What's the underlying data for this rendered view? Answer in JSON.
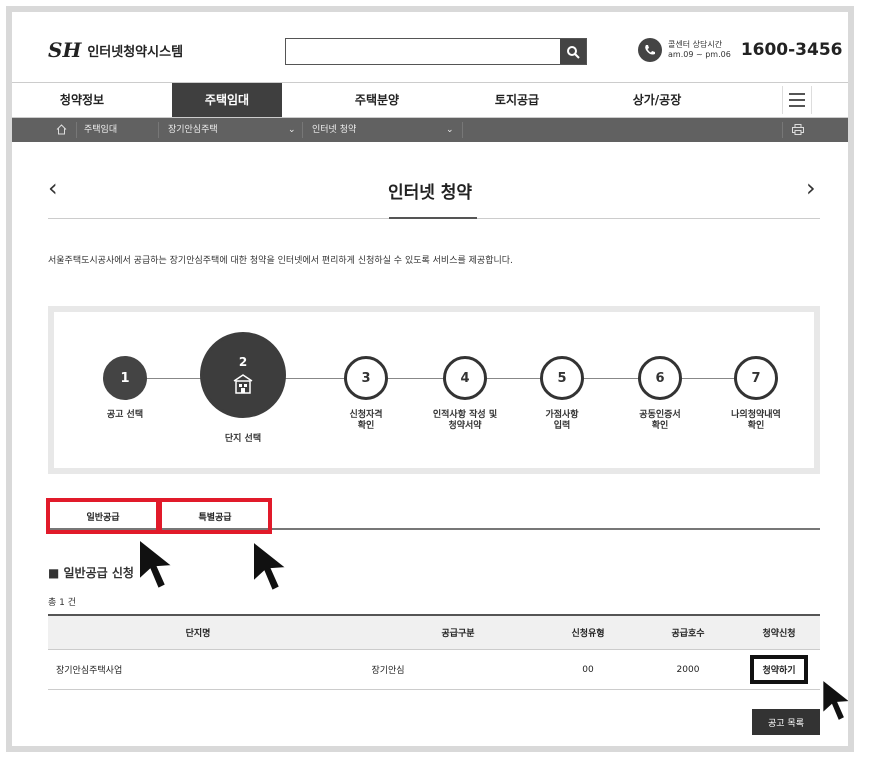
{
  "header": {
    "logo_mark": "SH",
    "logo_text": "인터넷청약시스템",
    "search_placeholder": "",
    "call_label_line1": "콜센터 상담시간",
    "call_label_line2": "am.09 ~ pm.06",
    "call_number": "1600-3456"
  },
  "nav": {
    "items": [
      "청약정보",
      "주택임대",
      "주택분양",
      "토지공급",
      "상가/공장"
    ],
    "active_index": 1
  },
  "breadcrumb": {
    "items": [
      "주택임대",
      "장기안심주택",
      "인터넷 청약"
    ]
  },
  "page": {
    "title": "인터넷 청약",
    "description": "서울주택도시공사에서 공급하는 장기안심주택에 대한 청약을 인터넷에서 편리하게 신청하실 수 있도록 서비스를 제공합니다."
  },
  "steps": [
    {
      "number": "1",
      "label": "공고 선택",
      "state": "done"
    },
    {
      "number": "2",
      "label": "단지 선택",
      "state": "current",
      "icon": "building-icon"
    },
    {
      "number": "3",
      "label": "신청자격\n확인",
      "state": "todo"
    },
    {
      "number": "4",
      "label": "인적사항 작성 및\n청약서약",
      "state": "todo"
    },
    {
      "number": "5",
      "label": "가점사항\n입력",
      "state": "todo"
    },
    {
      "number": "6",
      "label": "공동인증서\n확인",
      "state": "todo"
    },
    {
      "number": "7",
      "label": "나의청약내역\n확인",
      "state": "todo"
    }
  ],
  "tabs": [
    "일반공급",
    "특별공급"
  ],
  "section": {
    "title": "일반공급 신청",
    "total": "총 1 건"
  },
  "table": {
    "headers": [
      "단지명",
      "공급구분",
      "신청유형",
      "공급호수",
      "청약신청"
    ],
    "rows": [
      {
        "name": "장기안심주택사업",
        "type": "장기안심",
        "apply_type": "00",
        "units": "2000",
        "action": "청약하기"
      }
    ]
  },
  "buttons": {
    "list": "공고 목록"
  },
  "colors": {
    "highlight": "#e11a2a",
    "dark": "#3f3f3f"
  }
}
